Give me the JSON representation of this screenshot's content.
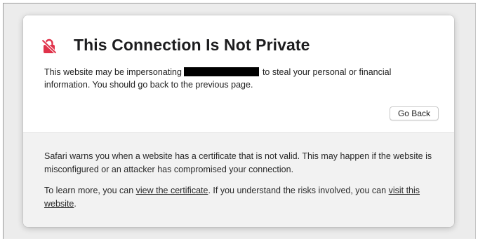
{
  "dialog": {
    "title": "This Connection Is Not Private",
    "message_before": "This website may be impersonating",
    "message_after": "to steal your personal or financial information. You should go back to the previous page.",
    "go_back_label": "Go Back"
  },
  "details": {
    "explanation": "Safari warns you when a website has a certificate that is not valid. This may happen if the website is misconfigured or an attacker has compromised your connection.",
    "learn_more_prefix": "To learn more, you can",
    "view_certificate_link": "view the certificate",
    "learn_more_middle": ". If you understand the risks involved, you can",
    "visit_website_link": "visit this website",
    "learn_more_suffix": "."
  },
  "icons": {
    "warning": "lock-slash-warning-icon"
  },
  "colors": {
    "warning_icon": "#e0324a",
    "text": "#222222",
    "panel": "#f2f2f2"
  }
}
